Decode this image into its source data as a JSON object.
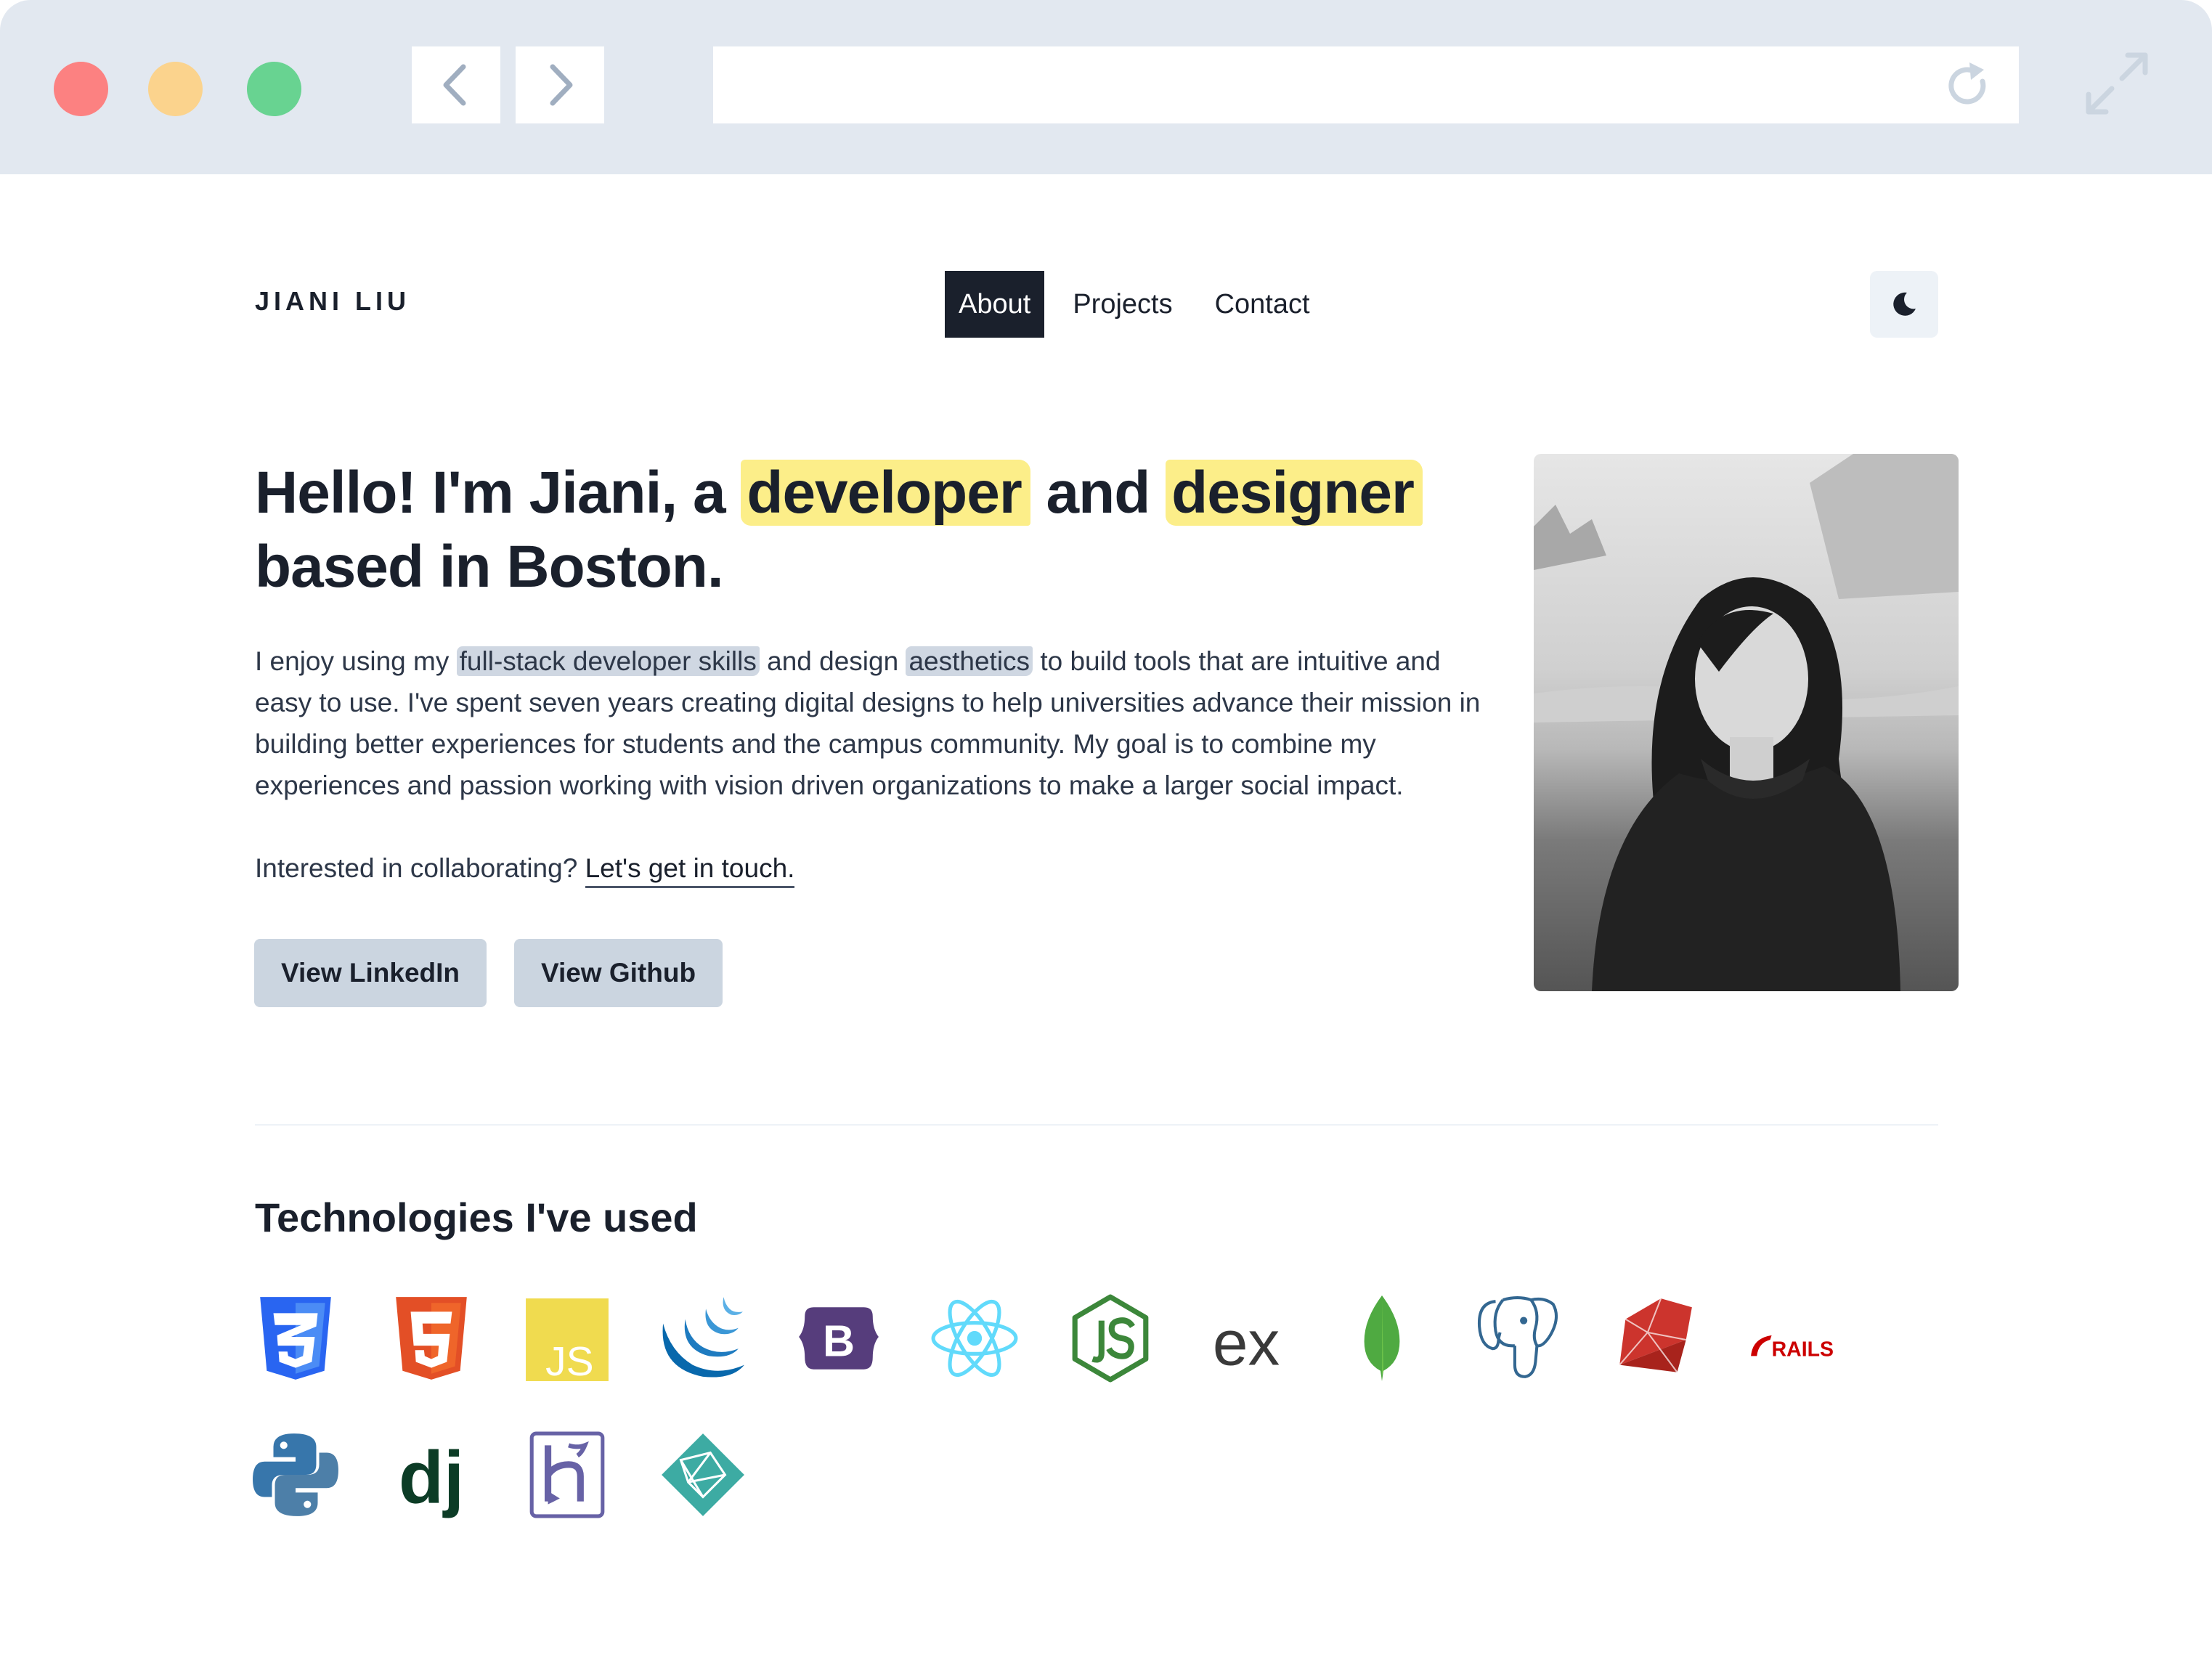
{
  "browser": {
    "buttons": {
      "back_icon": "chevron-left-icon",
      "forward_icon": "chevron-right-icon",
      "reload_icon": "reload-icon",
      "expand_icon": "expand-icon"
    },
    "url": ""
  },
  "header": {
    "brand": "JIANI LIU",
    "nav": [
      {
        "label": "About",
        "active": true
      },
      {
        "label": "Projects",
        "active": false
      },
      {
        "label": "Contact",
        "active": false
      }
    ],
    "theme_toggle_icon": "moon-icon"
  },
  "hero": {
    "title_part1": "Hello! I'm Jiani, a ",
    "title_highlight1": "developer",
    "title_part2": " and ",
    "title_highlight2": "designer",
    "title_part3": "based in Boston.",
    "bio_part1": "I enjoy using my ",
    "bio_highlight1": "full-stack developer skills",
    "bio_part2": " and design ",
    "bio_highlight2": "aesthetics",
    "bio_part3": " to build tools that are intuitive and easy to use. I've spent seven years creating digital designs to help universities advance their mission in building better experiences for students and the campus community. My goal is to combine my experiences and passion working with vision driven organizations to make a larger social impact.",
    "cta_text": "Interested in collaborating? ",
    "cta_link": "Let's get in touch.",
    "buttons": {
      "linkedin": "View LinkedIn",
      "github": "View Github"
    }
  },
  "technologies": {
    "title": "Technologies I've used",
    "icons": [
      "css3-icon",
      "html5-icon",
      "javascript-icon",
      "jquery-icon",
      "bootstrap-icon",
      "react-icon",
      "nodejs-icon",
      "express-icon",
      "mongodb-icon",
      "postgresql-icon",
      "ruby-icon",
      "rails-icon",
      "python-icon",
      "django-icon",
      "heroku-icon",
      "netlify-icon"
    ],
    "bootstrap_letter": "B",
    "express_text": "ex",
    "rails_text": "RAILS",
    "django_text": "dj"
  },
  "colors": {
    "highlight": "#fcee89",
    "accent_dark": "#1a202c",
    "button_bg": "#cbd5e0",
    "chrome_bg": "#e2e8f0"
  }
}
